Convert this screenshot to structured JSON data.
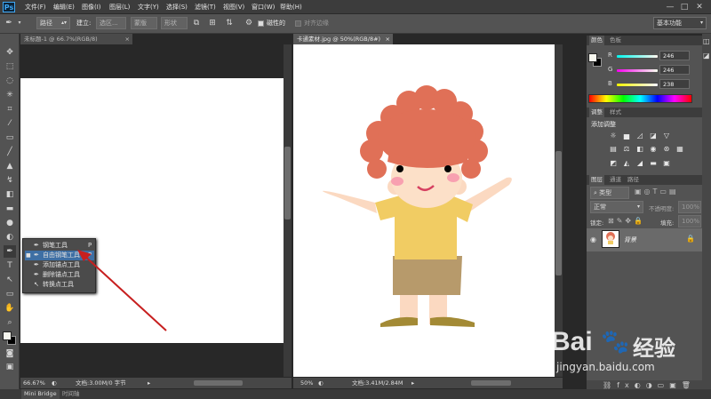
{
  "menubar": {
    "logo": "Ps",
    "items": [
      "文件(F)",
      "编辑(E)",
      "图像(I)",
      "图层(L)",
      "文字(Y)",
      "选择(S)",
      "滤镜(T)",
      "视图(V)",
      "窗口(W)",
      "帮助(H)"
    ],
    "minimize": "—",
    "restore": "□",
    "close": "✕"
  },
  "options": {
    "path_mode": "路径",
    "make_label": "建立:",
    "selection_btn": "选区...",
    "mask_btn": "蒙版",
    "shape_btn": "形状",
    "magnetic_label": "磁性的",
    "align_edges_label": "对齐边缘",
    "workspace": "基本功能"
  },
  "doc1": {
    "tab_title": "未标题-1 @ 66.7%(RGB/8)",
    "zoom": "66.67%",
    "info": "文档:3.00M/0 字节"
  },
  "doc2": {
    "tab_title": "卡通素材.jpg @ 50%(RGB/8#)",
    "zoom": "50%",
    "info": "文档:3.41M/2.84M"
  },
  "flyout": {
    "items": [
      {
        "label": "钢笔工具",
        "key": "P",
        "icon": "pen-icon"
      },
      {
        "label": "自由钢笔工具",
        "key": "P",
        "icon": "freeform-pen-icon",
        "selected": true
      },
      {
        "label": "添加锚点工具",
        "key": "",
        "icon": "add-anchor-icon"
      },
      {
        "label": "删除锚点工具",
        "key": "",
        "icon": "delete-anchor-icon"
      },
      {
        "label": "转换点工具",
        "key": "",
        "icon": "convert-point-icon"
      }
    ]
  },
  "color_panel": {
    "tabs": [
      "颜色",
      "色板"
    ],
    "r_label": "R",
    "g_label": "G",
    "b_label": "B",
    "r": "246",
    "g": "246",
    "b": "238"
  },
  "adjust_panel": {
    "tabs": [
      "调整",
      "样式"
    ],
    "title": "添加调整"
  },
  "layers_panel": {
    "tabs": [
      "图层",
      "通道",
      "路径"
    ],
    "filter_kind": "类型",
    "blend_mode": "正常",
    "opacity_label": "不透明度:",
    "opacity_value": "100%",
    "lock_label": "锁定:",
    "fill_label": "填充:",
    "fill_value": "100%",
    "layer_name": "背景"
  },
  "bottom_tabs": [
    "Mini Bridge",
    "时间轴"
  ],
  "watermark": {
    "brand": "Bai",
    "brand2": "经验",
    "url": "jingyan.baidu.com"
  }
}
